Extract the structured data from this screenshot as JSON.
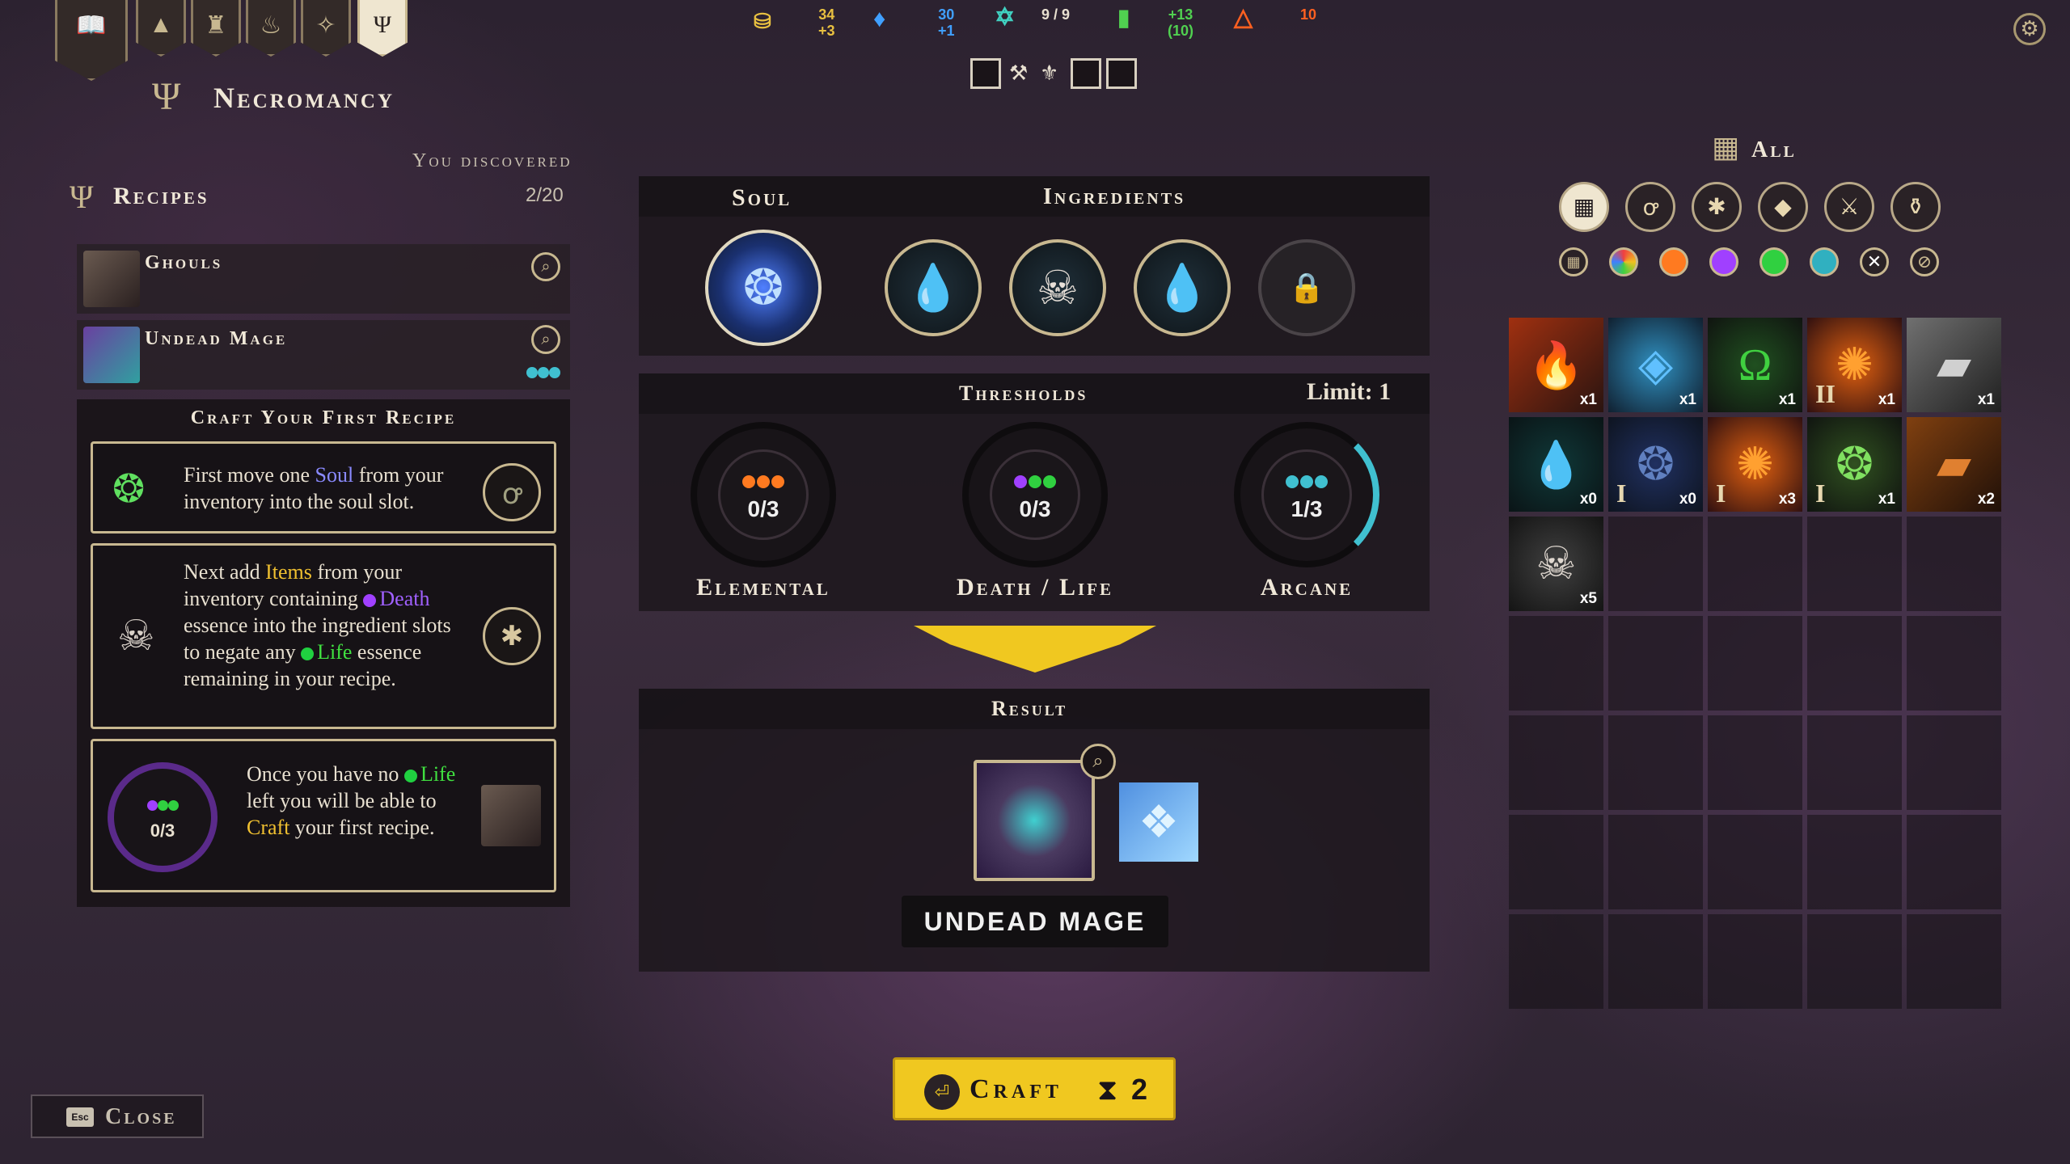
{
  "tabs": [
    "Codex",
    "Alchemy",
    "Tower",
    "Cooking",
    "Enchanting",
    "Necromancy"
  ],
  "header": {
    "title": "Necromancy"
  },
  "topbar": {
    "resources": [
      {
        "icon": "treasure-chest-icon",
        "value": "34",
        "delta": "+3",
        "color": "#e8c040"
      },
      {
        "icon": "blue-crystal-icon",
        "value": "30",
        "delta": "+1",
        "color": "#40a0ff"
      },
      {
        "icon": "pentagram-icon",
        "value": "9 / 9",
        "delta": "",
        "color": "#e8e0d0"
      },
      {
        "icon": "green-book-icon",
        "value": "+13",
        "delta": "(10)",
        "color": "#50d050"
      },
      {
        "icon": "orange-triangle-icon",
        "value": "10",
        "delta": "",
        "color": "#ff6020"
      }
    ]
  },
  "recipes": {
    "header": "Recipes",
    "discovered_label": "You discovered",
    "discovered_count": "2/20",
    "items": [
      {
        "name": "Ghouls"
      },
      {
        "name": "Undead Mage"
      }
    ]
  },
  "tutorial": {
    "header": "Craft Your First Recipe",
    "step1": {
      "a": "First move one ",
      "soul": "Soul",
      "b": " from your inventory into the soul slot."
    },
    "step2": {
      "a": "Next add ",
      "items": "Items",
      "b": " from your inventory containing ",
      "death": "Death",
      "c": " essence into the ingredient slots to negate any ",
      "life": "Life",
      "d": " essence remaining in your recipe."
    },
    "step3": {
      "a": "Once you have no ",
      "life": "Life",
      "b": " left you will be able to ",
      "craft": "Craft",
      "c": " your first recipe.",
      "gauge": "0/3"
    }
  },
  "center": {
    "soul_label": "Soul",
    "ingredients_label": "Ingredients",
    "thresholds_label": "Thresholds",
    "limit": "Limit: 1",
    "thresholds": [
      {
        "name": "Elemental",
        "value": "0/3",
        "color": "#ff7a20"
      },
      {
        "name": "Death / Life",
        "value": "0/3",
        "color": "#a040ff"
      },
      {
        "name": "Arcane",
        "value": "1/3",
        "color": "#40c0d0"
      }
    ],
    "result_label": "Result",
    "result_name": "UNDEAD MAGE"
  },
  "craft": {
    "label": "Craft",
    "count": "2"
  },
  "close": {
    "key": "Esc",
    "label": "Close"
  },
  "inventory": {
    "filter_label": "All",
    "cells": [
      {
        "icon": "fire-wand-icon",
        "count": "x1",
        "rom": ""
      },
      {
        "icon": "blue-gem-icon",
        "count": "x1",
        "rom": ""
      },
      {
        "icon": "green-horseshoe-icon",
        "count": "x1",
        "rom": ""
      },
      {
        "icon": "fire-essence-icon",
        "count": "x1",
        "rom": "II"
      },
      {
        "icon": "silver-bar-icon",
        "count": "x1",
        "rom": ""
      },
      {
        "icon": "water-drop-icon",
        "count": "x0",
        "rom": ""
      },
      {
        "icon": "blue-soul-icon",
        "count": "x0",
        "rom": "I"
      },
      {
        "icon": "fire-essence-icon",
        "count": "x3",
        "rom": "I"
      },
      {
        "icon": "green-swirl-icon",
        "count": "x1",
        "rom": "I"
      },
      {
        "icon": "bronze-bar-icon",
        "count": "x2",
        "rom": ""
      },
      {
        "icon": "skull-icon",
        "count": "x5",
        "rom": ""
      }
    ]
  }
}
